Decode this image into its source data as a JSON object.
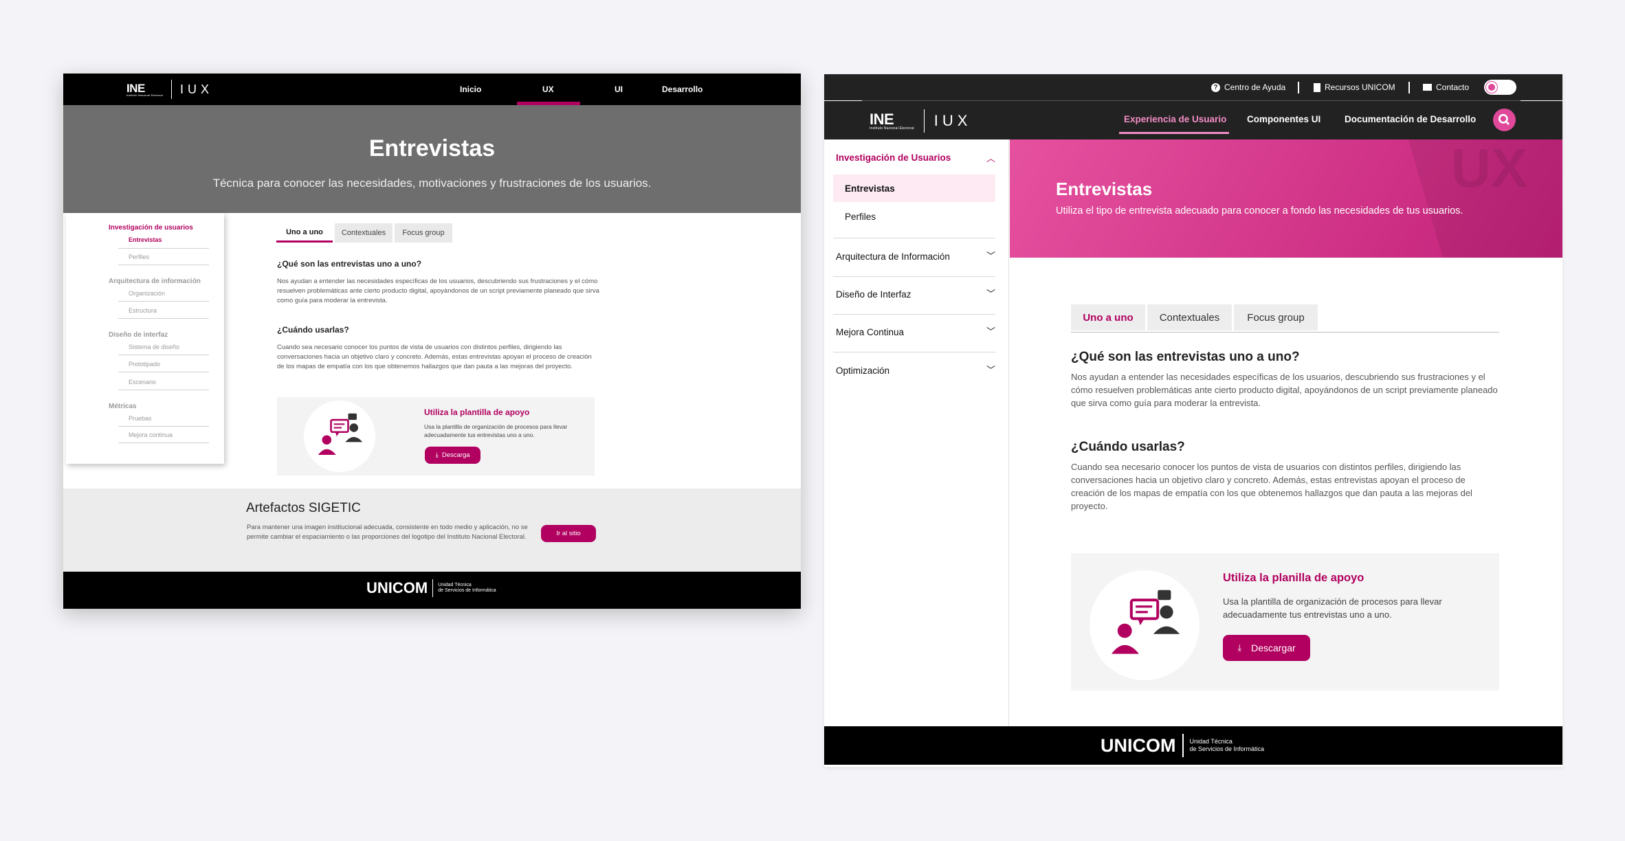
{
  "left": {
    "nav": {
      "logo": "INE",
      "logo_sub": "Instituto Nacional Electoral",
      "brand": "IUX",
      "items": [
        "Inicio",
        "UX",
        "UI",
        "Desarrollo"
      ]
    },
    "hero": {
      "title": "Entrevistas",
      "subtitle": "Técnica para conocer las necesidades, motivaciones y frustraciones de los usuarios."
    },
    "sidebar": {
      "sections": [
        {
          "title": "Investigación de usuarios",
          "items": [
            "Entrevistas",
            "Perfiles"
          ]
        },
        {
          "title": "Arquitectura de información",
          "items": [
            "Organización",
            "Estructura"
          ]
        },
        {
          "title": "Diseño de interfaz",
          "items": [
            "Sistema de diseño",
            "Prototipado",
            "Escenario"
          ]
        },
        {
          "title": "Métricas",
          "items": [
            "Pruebas",
            "Mejora continua"
          ]
        }
      ]
    },
    "tabs": [
      "Uno a uno",
      "Contextuales",
      "Focus group"
    ],
    "content": {
      "q1": "¿Qué son las entrevistas uno a uno?",
      "p1": "Nos ayudan a entender las necesidades específicas de los usuarios, descubriendo sus frustraciones y el cómo resuelven problemáticas ante cierto producto digital, apoyándonos de un script previamente planeado que sirva como guía para moderar la entrevista.",
      "q2": "¿Cuándo usarlas?",
      "p2": "Cuando sea necesario conocer los puntos de vista de usuarios con distintos perfiles, dirigiendo las conversaciones hacia un objetivo claro y concreto. Además, estas entrevistas apoyan el proceso de creación de los mapas de empatía con los que obtenemos hallazgos que dan pauta a las mejoras del proyecto."
    },
    "card": {
      "title": "Utiliza la plantilla de apoyo",
      "text": "Usa la plantilla de organización de procesos para llevar adecuadamente tus entrevistas uno a uno.",
      "button": "Descarga"
    },
    "artefactos": {
      "title": "Artefactos SIGETIC",
      "text": "Para mantener una imagen institucional adecuada, consistente en todo medio y aplicación, no se permite cambiar el espaciamiento o las proporciones del logotipo del Instituto Nacional Electoral.",
      "button": "Ir al sitio"
    },
    "footer": {
      "brand": "UNICOM",
      "line1": "Unidad Técnica",
      "line2": "de Servicios de Informática"
    }
  },
  "right": {
    "topbar": {
      "help": "Centro de Ayuda",
      "resources": "Recursos UNICOM",
      "contact": "Contacto"
    },
    "nav": {
      "logo": "INE",
      "logo_sub": "Instituto Nacional Electoral",
      "brand": "IUX",
      "items": [
        "Experiencia de Usuario",
        "Componentes UI",
        "Documentación de Desarrollo"
      ]
    },
    "sidebar": {
      "open_section": "Investigación de Usuarios",
      "open_items": [
        "Entrevistas",
        "Perfiles"
      ],
      "sections": [
        "Arquitectura de Información",
        "Diseño de Interfaz",
        "Mejora Continua",
        "Optimización"
      ]
    },
    "hero": {
      "title": "Entrevistas",
      "subtitle": "Utiliza el tipo de entrevista adecuado para conocer a fondo las necesidades de tus usuarios.",
      "watermark": "UX"
    },
    "tabs": [
      "Uno a uno",
      "Contextuales",
      "Focus group"
    ],
    "content": {
      "q1": "¿Qué son las entrevistas uno a uno?",
      "p1": "Nos ayudan a entender las necesidades específicas de los usuarios, descubriendo sus frustraciones y el cómo resuelven problemáticas ante cierto producto digital, apoyándonos de un script previamente planeado que sirva como guía para moderar la entrevista.",
      "q2": "¿Cuándo usarlas?",
      "p2": "Cuando sea necesario conocer los puntos de vista de usuarios con distintos perfiles, dirigiendo las conversaciones hacia un objetivo claro y concreto. Además, estas entrevistas apoyan el proceso de creación de los mapas de empatía con los que obtenemos hallazgos que dan pauta a las mejoras del proyecto."
    },
    "card": {
      "title": "Utiliza la planilla de apoyo",
      "text": "Usa la plantilla de organización de procesos para llevar adecuadamente tus entrevistas uno a uno.",
      "button": "Descargar"
    },
    "footer": {
      "brand": "UNICOM",
      "line1": "Unidad Técnica",
      "line2": "de Servicios de Informática"
    }
  },
  "colors": {
    "magenta": "#b1005f",
    "pink": "#e0489a",
    "dark": "#222222",
    "grey_hero": "#6e6e6e"
  }
}
